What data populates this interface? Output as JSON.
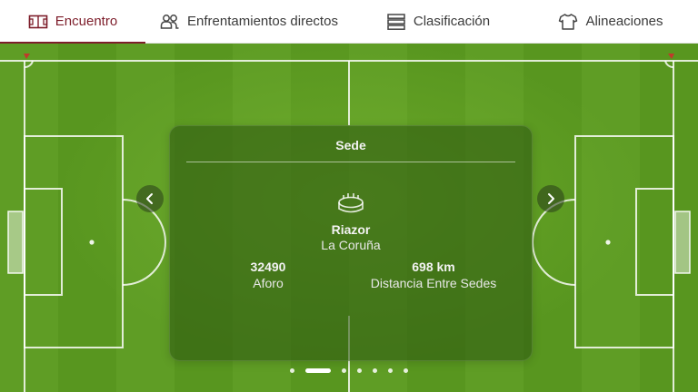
{
  "tabs": [
    {
      "label": "Encuentro",
      "icon": "match-board-icon",
      "active": true
    },
    {
      "label": "Enfrentamientos directos",
      "icon": "head-to-head-icon",
      "active": false
    },
    {
      "label": "Clasificación",
      "icon": "standings-icon",
      "active": false
    },
    {
      "label": "Alineaciones",
      "icon": "jersey-icon",
      "active": false
    }
  ],
  "card": {
    "title": "Sede",
    "venue_name": "Riazor",
    "venue_city": "La Coruña",
    "stats": [
      {
        "value": "32490",
        "label": "Aforo"
      },
      {
        "value": "698 km",
        "label": "Distancia Entre Sedes"
      }
    ]
  },
  "carousel": {
    "slides": 7,
    "active_index": 1
  },
  "colors": {
    "accent": "#7d1d2a",
    "pitch": "#5f9d25",
    "card_bg": "rgba(48,92,18,0.62)"
  }
}
